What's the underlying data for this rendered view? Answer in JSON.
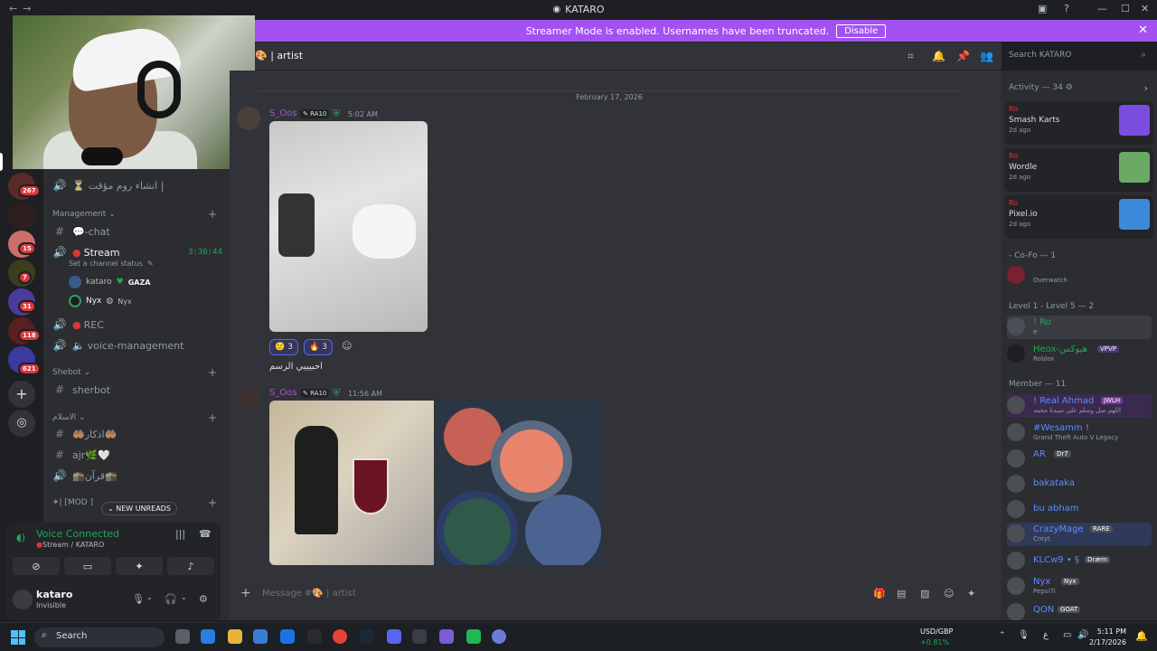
{
  "window": {
    "title": "KATARO",
    "nav_back": "←",
    "nav_fwd": "→",
    "inbox_icon": "inbox-icon",
    "help_icon": "help-icon"
  },
  "banner": {
    "text": "Streamer Mode is enabled. Usernames have been truncated.",
    "button": "Disable",
    "close": "✕",
    "color": "#a352f1"
  },
  "guild_badges": [
    "267",
    "15",
    "7",
    "31",
    "118",
    "621"
  ],
  "channels": {
    "top_voice": "انشاء روم مؤقت |",
    "top_voice_emoji": "⏳",
    "cat_management": "Management",
    "chat": "💬-chat",
    "stream": "Stream",
    "stream_timer": "3:36:44",
    "stream_status": "Set a channel status",
    "stream_users": [
      {
        "name": "kataro",
        "tag": "GAZA"
      },
      {
        "name": "Nyx",
        "tag": "Nyx"
      }
    ],
    "rec": "REC",
    "voice_management": "voice-management",
    "cat_shebot": "Shebot",
    "sherbot": "sherbot",
    "cat_islam": "الاسلام",
    "azkar": "🤲🏽اذكار🤲🏽",
    "ajr": "ajr🌿🤍",
    "quran": "🕋قرآن🕋",
    "cat_mod": "✶|  [MOD ]",
    "new_unreads": "NEW UNREADS"
  },
  "voice": {
    "connected": "Voice Connected",
    "sub": "Stream / KATARO"
  },
  "user": {
    "name": "kataro",
    "status": "Invisible"
  },
  "header": {
    "channel": "| artist",
    "search_placeholder": "Search KATARO"
  },
  "messages": {
    "date": "February 17, 2026",
    "m1": {
      "author": "S_Oos",
      "tag": "RA10",
      "time": "5:02 AM"
    },
    "reactions": [
      {
        "emoji": "🙂",
        "count": "3"
      },
      {
        "emoji": "🔥",
        "count": "3"
      }
    ],
    "m1_text": "احبيييي الرسم",
    "m2": {
      "author": "S_Oos",
      "tag": "RA10",
      "time": "11:56 AM"
    }
  },
  "composer": {
    "placeholder": "Message #🎨 | artist"
  },
  "activity": {
    "header": "Activity — 34",
    "items": [
      {
        "user": "Ro",
        "game": "Smash Karts",
        "ago": "2d ago",
        "color": "#7a4de0"
      },
      {
        "user": "Ro",
        "game": "Wordle",
        "ago": "2d ago",
        "color": "#6aaa64"
      },
      {
        "user": "Ro",
        "game": "Pixel.io",
        "ago": "2d ago",
        "color": "#3c8ad9"
      }
    ]
  },
  "members": {
    "cofo_header": "- Co-Fo — 1",
    "cofo": [
      {
        "name": "",
        "status": "Overwatch"
      }
    ],
    "level_header": "Level 1 - Level 5 — 2",
    "level": [
      {
        "name": "! Ro",
        "status": "e",
        "tag": ""
      },
      {
        "name": "Heox-هيوكس",
        "status": "Roblox",
        "tag": "VPVP"
      }
    ],
    "member_header": "Member — 11",
    "list": [
      {
        "name": "! Real Ahmad",
        "status": "اللهم صل وسلم على سيدنا محمد",
        "tag": "JWLH",
        "color": "#5e8bff"
      },
      {
        "name": "#Wesamm !",
        "status": "Grand Theft Auto V Legacy",
        "tag": "",
        "color": "#5e8bff"
      },
      {
        "name": "AR",
        "status": "",
        "tag": "Dr7",
        "color": "#5e8bff"
      },
      {
        "name": "bakataka",
        "status": "",
        "tag": "",
        "color": "#5e8bff"
      },
      {
        "name": "bu abham",
        "status": "",
        "tag": "",
        "color": "#5e8bff"
      },
      {
        "name": "CrazyMage",
        "status": "Cmyt",
        "tag": "RARE",
        "color": "#5e8bff"
      },
      {
        "name": "KLCw9 • §",
        "status": "",
        "tag": "Dræm",
        "color": "#5e8bff"
      },
      {
        "name": "Nyx",
        "status": "Pepsi7i",
        "tag": "Nyx",
        "color": "#5e8bff"
      },
      {
        "name": "QON",
        "status": "",
        "tag": "GOAT",
        "color": "#5e8bff"
      }
    ]
  },
  "taskbar": {
    "search": "Search",
    "fx_pair": "USD/GBP",
    "fx_change": "+0.81%",
    "time": "5:11 PM",
    "date": "2/17/2026",
    "lang": "ع"
  }
}
